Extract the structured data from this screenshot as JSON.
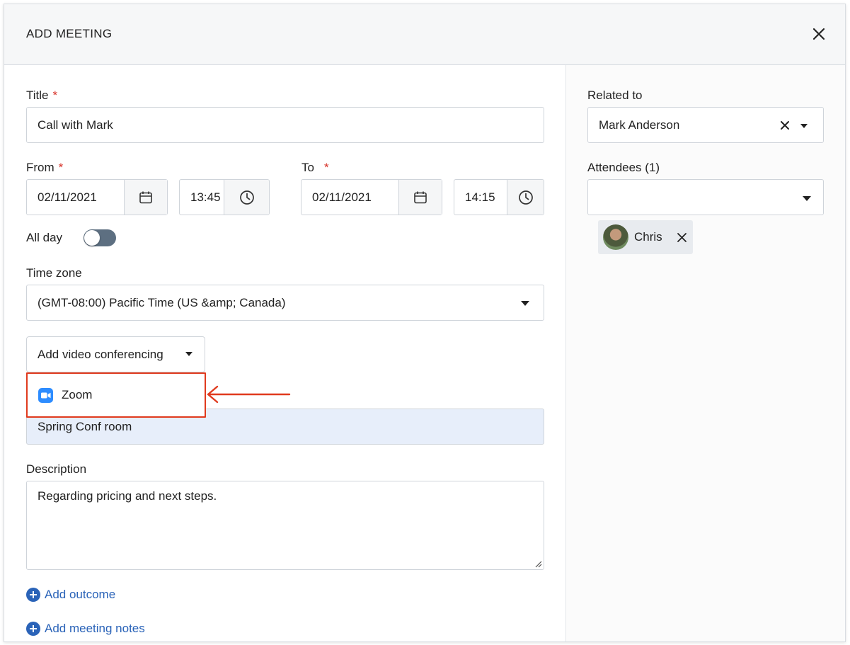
{
  "modal": {
    "title": "ADD MEETING"
  },
  "form": {
    "title_label": "Title",
    "title_value": "Call with Mark",
    "from_label": "From",
    "from_date": "02/11/2021",
    "from_time": "13:45",
    "to_label": "To",
    "to_date": "02/11/2021",
    "to_time": "14:15",
    "required_mark": "*",
    "all_day_label": "All day",
    "all_day_on": false,
    "timezone_label": "Time zone",
    "timezone_value": "(GMT-08:00) Pacific Time (US &amp; Canada)",
    "video_button_label": "Add video conferencing",
    "video_options": [
      "Zoom"
    ],
    "location_value": "Spring Conf room",
    "description_label": "Description",
    "description_value": "Regarding pricing and next steps.",
    "add_outcome_label": "Add outcome",
    "add_notes_label": "Add meeting notes"
  },
  "sidebar": {
    "related_label": "Related to",
    "related_value": "Mark Anderson",
    "attendees_label": "Attendees (1)",
    "attendees": [
      {
        "name": "Chris"
      }
    ]
  },
  "colors": {
    "accent_link": "#2a63b8",
    "required": "#d7342b",
    "highlight_border": "#e03a1e",
    "zoom_blue": "#2d8cff",
    "location_bg": "#e7eefa"
  },
  "icons": [
    "close-icon",
    "calendar-icon",
    "clock-icon",
    "caret-down-icon",
    "zoom-icon",
    "plus-circle-icon",
    "resize-handle-icon",
    "clear-icon",
    "remove-attendee-icon"
  ]
}
